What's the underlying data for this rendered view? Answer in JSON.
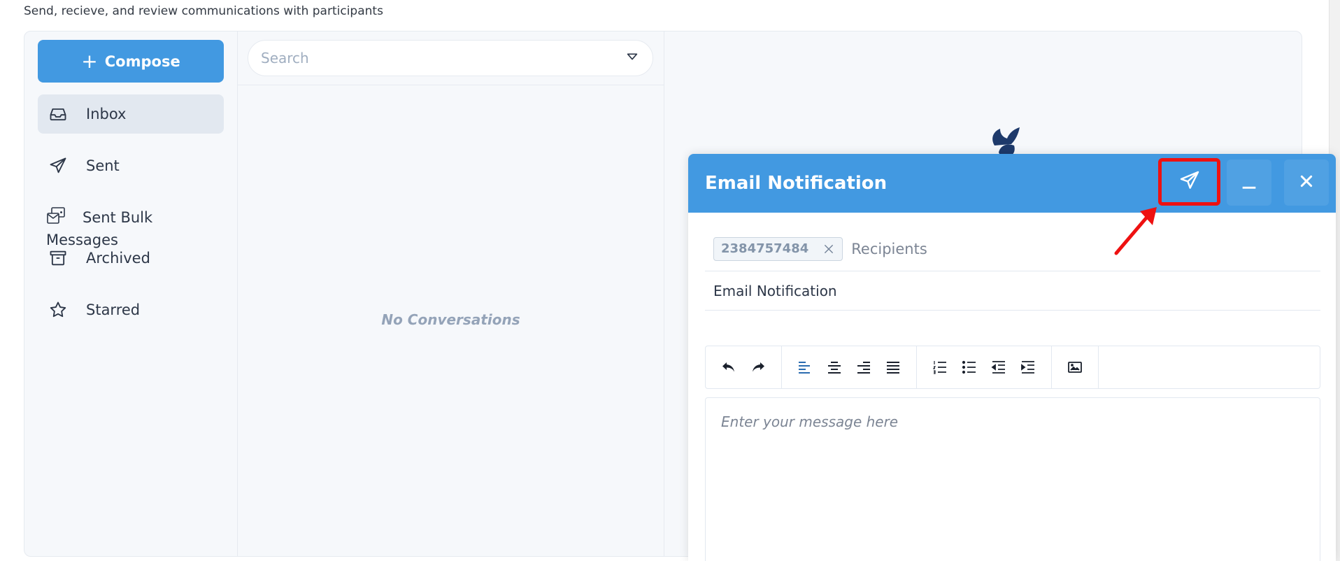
{
  "page": {
    "subtitle": "Send, recieve, and review communications with participants"
  },
  "sidebar": {
    "compose_label": "Compose",
    "compose_plus": "+",
    "items": [
      {
        "label": "Inbox",
        "icon": "inbox-icon",
        "active": true
      },
      {
        "label": "Sent",
        "icon": "paper-plane-icon"
      },
      {
        "label": "Sent Bulk Messages",
        "icon": "bulk-mail-icon"
      },
      {
        "label": "Archived",
        "icon": "archive-box-icon"
      },
      {
        "label": "Starred",
        "icon": "star-icon"
      }
    ]
  },
  "conversations": {
    "search_placeholder": "Search",
    "empty_text": "No Conversations"
  },
  "compose_modal": {
    "title": "Email Notification",
    "recipient_chips": [
      "2384757484"
    ],
    "recipients_placeholder": "Recipients",
    "subject": "Email Notification",
    "message_placeholder": "Enter your message here",
    "toolbar_icons": [
      "undo-icon",
      "redo-icon",
      "align-left-icon",
      "align-center-icon",
      "align-right-icon",
      "align-justify-icon",
      "ordered-list-icon",
      "bullet-list-icon",
      "outdent-icon",
      "indent-icon",
      "image-icon"
    ]
  },
  "colors": {
    "accent": "#4299e1",
    "highlight_box": "#ee1111",
    "sidebar_active_bg": "#e2e8f0",
    "panel_bg": "#f6f8fb"
  }
}
